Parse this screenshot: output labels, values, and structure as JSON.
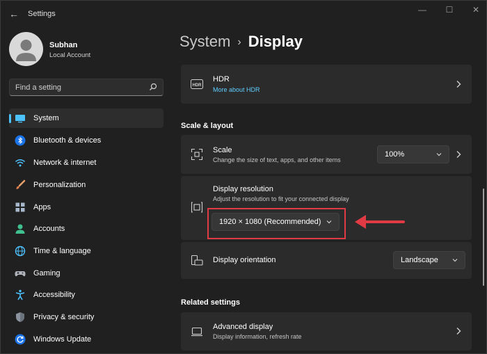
{
  "window": {
    "title": "Settings",
    "controls": {
      "minimize": "—",
      "maximize": "☐",
      "close": "✕"
    }
  },
  "profile": {
    "name": "Subhan",
    "account_type": "Local Account"
  },
  "search": {
    "placeholder": "Find a setting"
  },
  "sidebar": {
    "items": [
      {
        "label": "System",
        "icon": "monitor-icon",
        "active": true
      },
      {
        "label": "Bluetooth & devices",
        "icon": "bluetooth-icon"
      },
      {
        "label": "Network & internet",
        "icon": "wifi-icon"
      },
      {
        "label": "Personalization",
        "icon": "brush-icon"
      },
      {
        "label": "Apps",
        "icon": "apps-icon"
      },
      {
        "label": "Accounts",
        "icon": "person-icon"
      },
      {
        "label": "Time & language",
        "icon": "clock-globe-icon"
      },
      {
        "label": "Gaming",
        "icon": "gamepad-icon"
      },
      {
        "label": "Accessibility",
        "icon": "accessibility-icon"
      },
      {
        "label": "Privacy & security",
        "icon": "shield-icon"
      },
      {
        "label": "Windows Update",
        "icon": "update-icon"
      }
    ]
  },
  "breadcrumb": {
    "parent": "System",
    "separator": "›",
    "current": "Display"
  },
  "hdr": {
    "icon_text": "HDR",
    "title": "HDR",
    "link": "More about HDR"
  },
  "scale_layout": {
    "header": "Scale & layout",
    "scale": {
      "title": "Scale",
      "subtitle": "Change the size of text, apps, and other items",
      "value": "100%"
    },
    "resolution": {
      "title": "Display resolution",
      "subtitle": "Adjust the resolution to fit your connected display",
      "value": "1920 × 1080 (Recommended)"
    },
    "orientation": {
      "title": "Display orientation",
      "value": "Landscape"
    }
  },
  "related": {
    "header": "Related settings",
    "advanced": {
      "title": "Advanced display",
      "subtitle": "Display information, refresh rate"
    }
  },
  "colors": {
    "accent": "#4cc2ff",
    "link": "#60cdff",
    "annotation": "#e03b44"
  }
}
